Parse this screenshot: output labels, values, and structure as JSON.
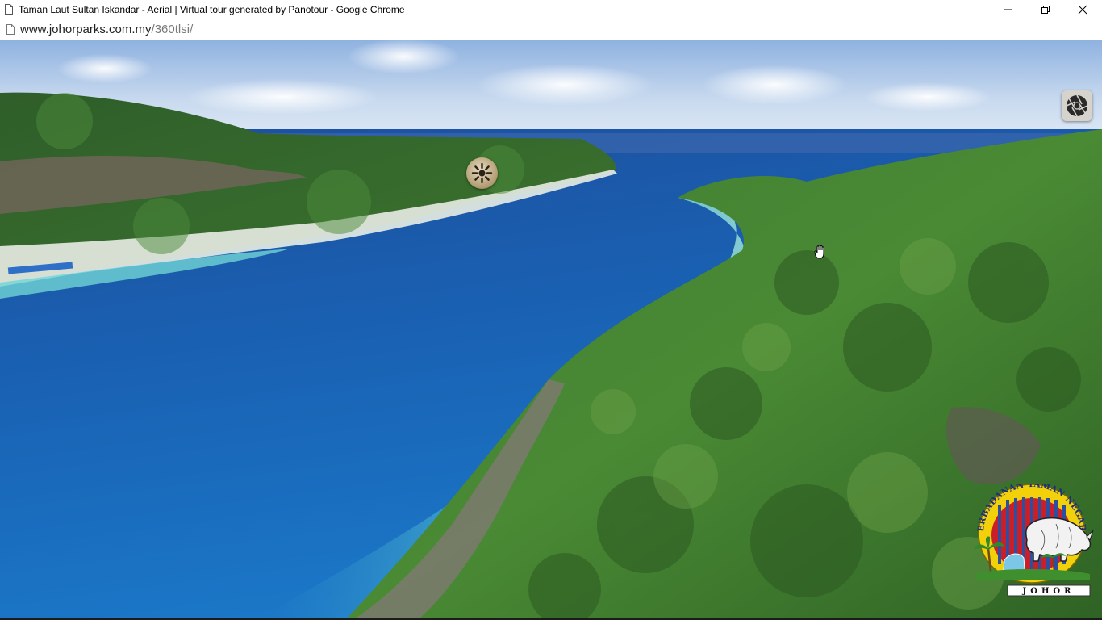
{
  "window": {
    "title": "Taman Laut Sultan Iskandar - Aerial | Virtual tour generated by Panotour - Google Chrome",
    "controls": [
      "minimize",
      "restore",
      "close"
    ]
  },
  "address_bar": {
    "host": "www.johorparks.com.my",
    "path": "/360tlsi/"
  },
  "pano": {
    "hotspot_icon": "sun-hotspot-icon",
    "toolbar_icon": "shutter-icon",
    "cursor_icon": "hand-cursor-icon",
    "logo": {
      "ring_text": "PERBADANAN TAMAN NEGARA",
      "banner_text": "JOHOR"
    }
  },
  "colors": {
    "deep_sea": "#1a5aa8",
    "shallow_water": "#5ec9cf",
    "forest": "#3c7a2a",
    "sky": "#bcd3ee",
    "logo_yellow": "#f2d10a",
    "logo_red": "#c8202a",
    "logo_blue": "#2d4fa0"
  }
}
